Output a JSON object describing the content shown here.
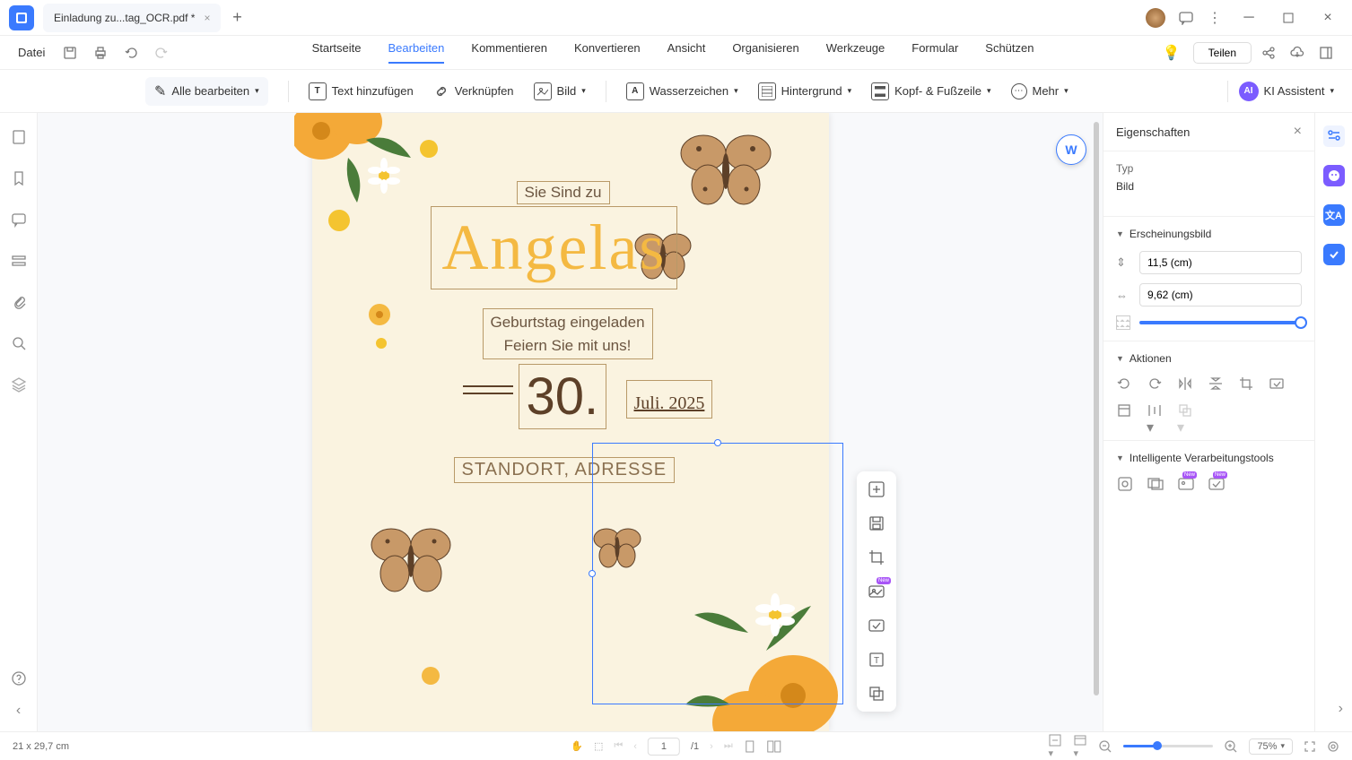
{
  "tab": {
    "name": "Einladung zu...tag_OCR.pdf *"
  },
  "menu": {
    "file": "Datei",
    "tabs": [
      "Startseite",
      "Bearbeiten",
      "Kommentieren",
      "Konvertieren",
      "Ansicht",
      "Organisieren",
      "Werkzeuge",
      "Formular",
      "Schützen"
    ],
    "active": "Bearbeiten",
    "share": "Teilen"
  },
  "toolbar": {
    "edit_all": "Alle bearbeiten",
    "add_text": "Text hinzufügen",
    "link": "Verknüpfen",
    "image": "Bild",
    "watermark": "Wasserzeichen",
    "background": "Hintergrund",
    "header_footer": "Kopf- & Fußzeile",
    "more": "Mehr",
    "ai": "KI Assistent"
  },
  "document": {
    "text1": "Sie Sind zu",
    "text2": "Angelas",
    "text3_l1": "Geburtstag eingeladen",
    "text3_l2": "Feiern Sie mit uns!",
    "big_number": "30.",
    "date_suffix": "Juli. 2025",
    "location": "STANDORT, ADRESSE"
  },
  "props": {
    "title": "Eigenschaften",
    "type_label": "Typ",
    "type_value": "Bild",
    "appearance": "Erscheinungsbild",
    "height": "11,5 (cm)",
    "width": "9,62 (cm)",
    "actions": "Aktionen",
    "tools": "Intelligente Verarbeitungstools"
  },
  "status": {
    "dims": "21 x 29,7 cm",
    "page_current": "1",
    "page_total": "/1",
    "zoom": "75%"
  }
}
